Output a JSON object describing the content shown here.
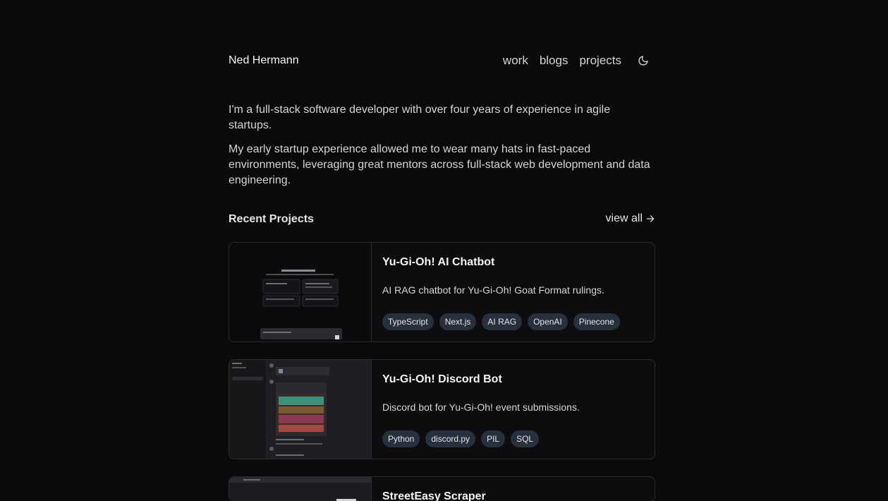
{
  "header": {
    "brand": "Ned Hermann",
    "nav": [
      "work",
      "blogs",
      "projects"
    ],
    "theme_icon": "moon-icon"
  },
  "bio": {
    "p1": "I'm a full-stack software developer with over four years of experience in agile startups.",
    "p2": "My early startup experience allowed me to wear many hats in fast-paced environments, leveraging great mentors across full-stack web development and data engineering."
  },
  "projects": {
    "title": "Recent Projects",
    "view_all": "view all",
    "items": [
      {
        "title": "Yu-Gi-Oh! AI Chatbot",
        "description": "AI RAG chatbot for Yu-Gi-Oh! Goat Format rulings.",
        "tags": [
          "TypeScript",
          "Next.js",
          "AI RAG",
          "OpenAI",
          "Pinecone"
        ]
      },
      {
        "title": "Yu-Gi-Oh! Discord Bot",
        "description": "Discord bot for Yu-Gi-Oh! event submissions.",
        "tags": [
          "Python",
          "discord.py",
          "PIL",
          "SQL"
        ]
      },
      {
        "title": "StreetEasy Scraper",
        "description": "",
        "tags": []
      }
    ]
  }
}
